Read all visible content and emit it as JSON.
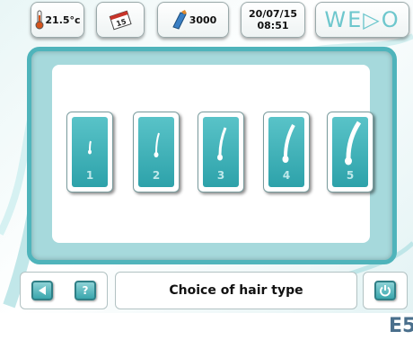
{
  "topbar": {
    "temperature": "21.5°c",
    "calendar_day": "15",
    "counter": "3000",
    "date": "20/07/15",
    "time": "08:51",
    "logo": "WE▷O"
  },
  "hair_types": [
    {
      "label": "1"
    },
    {
      "label": "2"
    },
    {
      "label": "3"
    },
    {
      "label": "4"
    },
    {
      "label": "5"
    }
  ],
  "bottombar": {
    "title": "Choice of hair type",
    "help_label": "?"
  },
  "figure_code": "E5",
  "icons": [
    "thermometer-icon",
    "calendar-icon",
    "handpiece-icon",
    "back-arrow-icon",
    "help-icon",
    "power-icon"
  ],
  "colors": {
    "accent": "#4fb4bb",
    "tile": "#2da2aa",
    "frame": "#a6d9dc"
  }
}
